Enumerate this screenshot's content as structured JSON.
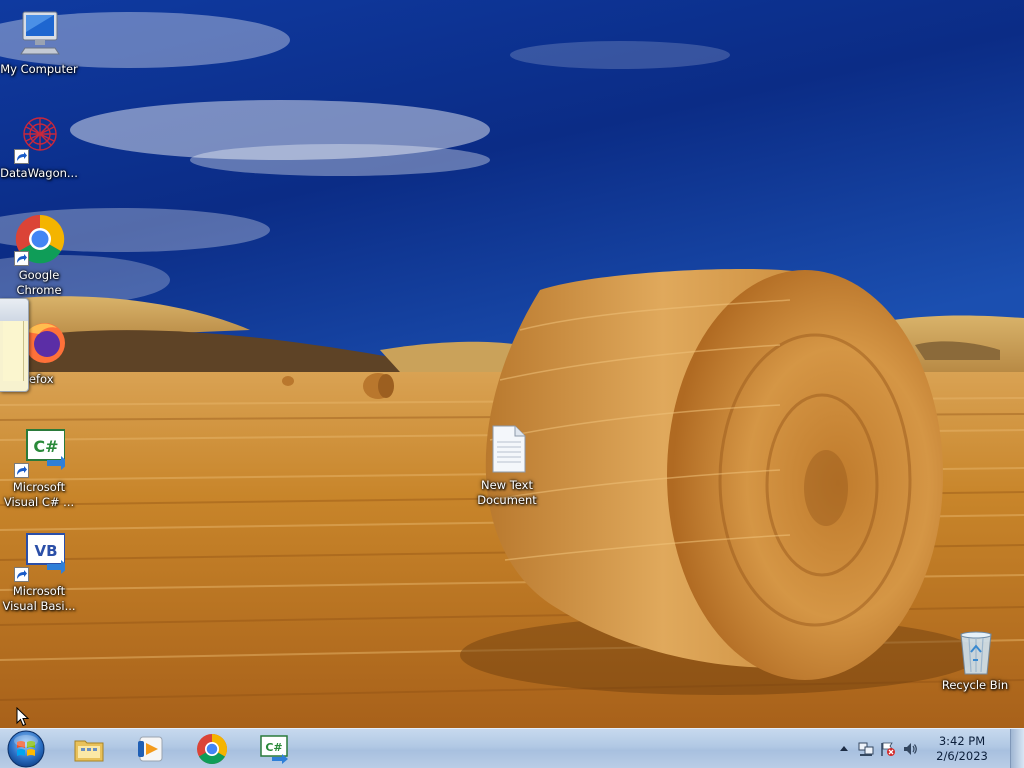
{
  "desktop": {
    "icons": [
      {
        "id": "my-computer",
        "label": "My Computer",
        "icon": "computer-icon"
      },
      {
        "id": "datawagon",
        "label": "DataWagon...",
        "icon": "datawagon-icon"
      },
      {
        "id": "google-chrome",
        "label": "Google Chrome",
        "icon": "chrome-icon"
      },
      {
        "id": "firefox",
        "label": "refox",
        "icon": "firefox-icon"
      },
      {
        "id": "visual-csharp",
        "label": "Microsoft Visual C# ...",
        "icon": "visual-csharp-icon"
      },
      {
        "id": "visual-basic",
        "label": "Microsoft Visual Basi...",
        "icon": "visual-basic-icon"
      },
      {
        "id": "new-text-document",
        "label": "New Text Document",
        "icon": "text-document-icon"
      },
      {
        "id": "recycle-bin",
        "label": "Recycle Bin",
        "icon": "recycle-bin-icon"
      }
    ]
  },
  "taskbar": {
    "start": {
      "icon": "windows-start-orb-icon"
    },
    "pinned": [
      {
        "name": "Windows Explorer",
        "icon": "folder-explorer-icon"
      },
      {
        "name": "Windows Media Player",
        "icon": "media-player-icon"
      },
      {
        "name": "Google Chrome",
        "icon": "chrome-icon"
      },
      {
        "name": "Microsoft Visual C#",
        "icon": "visual-csharp-icon"
      }
    ],
    "tray": {
      "icons": [
        "show-hidden-icons-arrow",
        "network-icon",
        "action-center-flag-icon",
        "volume-icon"
      ],
      "time": "3:42 PM",
      "date": "2/6/2023"
    }
  },
  "colors": {
    "sky": "#0a2f86",
    "field": "#c8852a",
    "taskbar": "#b1c8e4",
    "label_text": "#ffffff"
  }
}
